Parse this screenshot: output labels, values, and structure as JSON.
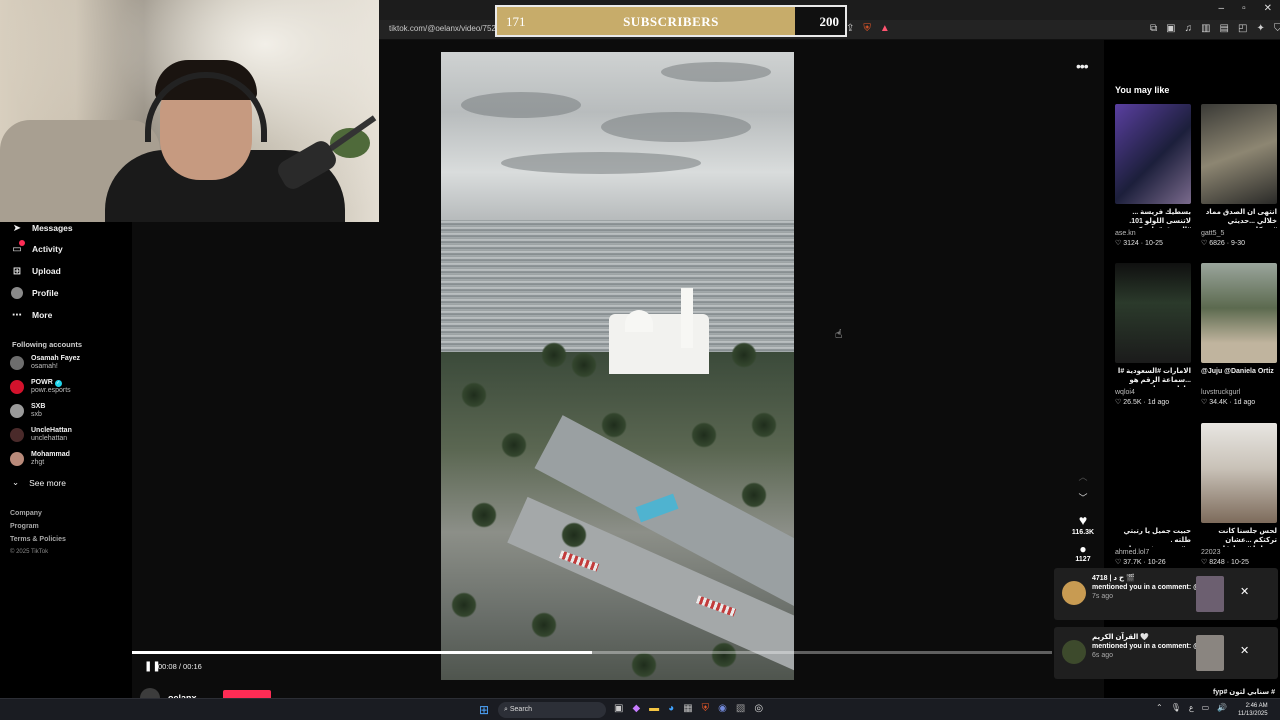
{
  "browser": {
    "url": "tiktok.com/@oelanx/video/752013",
    "window_controls": [
      "–",
      "▫",
      "✕"
    ]
  },
  "subscriber_goal": {
    "current": "171",
    "label": "SUBSCRIBERS",
    "goal": "200",
    "progress_fraction": 0.855,
    "fill_color": "#c7ac6a"
  },
  "sidebar": {
    "nav": [
      {
        "label": "Messages",
        "icon": "paper-plane-icon"
      },
      {
        "label": "Activity",
        "icon": "inbox-icon"
      },
      {
        "label": "Upload",
        "icon": "plus-square-icon"
      },
      {
        "label": "Profile",
        "icon": "avatar"
      },
      {
        "label": "More",
        "icon": "ellipsis-icon"
      }
    ],
    "following_title": "Following accounts",
    "accounts": [
      {
        "name": "Osamah Fayez",
        "handle": "osamah!"
      },
      {
        "name": "POWR",
        "handle": "powr.esports"
      },
      {
        "name": "SXB",
        "handle": "sxb"
      },
      {
        "name": "UncleHattan",
        "handle": "unclehattan"
      },
      {
        "name": "Mohammad",
        "handle": "zhgt"
      }
    ],
    "see_more": "See more",
    "footer": [
      "Company",
      "Program",
      "Terms & Policies"
    ],
    "copyright": "© 2025 TikTok"
  },
  "player": {
    "time": "00:08 / 00:16",
    "progress_fraction": 0.5,
    "author": "oelanx",
    "likes": "116.3K",
    "comments": "1127",
    "more": "•••"
  },
  "recommendations": {
    "title": "You may like",
    "cards": [
      {
        "caption": "بسطيك فريسة ... لاتنسى اللولو 101. #الشرق #ماهركو",
        "user": "ase.kn",
        "likes": "3124",
        "date": "10-25"
      },
      {
        "caption": "انتهى ان الصدق مماد خلالي ...حديثي #بودكاست",
        "user": "gatt5_5",
        "likes": "6826",
        "date": "9-30"
      },
      {
        "caption": "الامارات #السعودية #ا ...سماعة الرقم هو حاطه بحسابه",
        "user": "wqloi4",
        "likes": "26.5K",
        "date": "1d ago"
      },
      {
        "caption": "@Juju @Daniela Ortiz",
        "user": "luvstruckgurl",
        "likes": "34.4K",
        "date": "1d ago"
      },
      {
        "caption": "حبيت جميل يا رتبتي طلته . ...#تصميم_فيديوهات",
        "user": "ahmed.lol7",
        "likes": "37.7K",
        "date": "10-26"
      },
      {
        "caption": "لحس جلسنا كانت تركتكم ...عشان ترسلها #مسابقات",
        "user": "22023",
        "likes": "8248",
        "date": "10-25"
      }
    ],
    "bottom_caption": "# سنابي لتون #fyp"
  },
  "notifications": [
    {
      "title": "4718 | ح د 🎬",
      "text": "mentioned you in a comment: @YSMO",
      "time": "7s ago"
    },
    {
      "title": "القرآن الكريم 🤍",
      "text": "mentioned you in a comment: @YSMO",
      "time": "6s ago"
    }
  ],
  "taskbar": {
    "search": "Search",
    "time": "2:46 AM",
    "date": "11/13/2025"
  }
}
